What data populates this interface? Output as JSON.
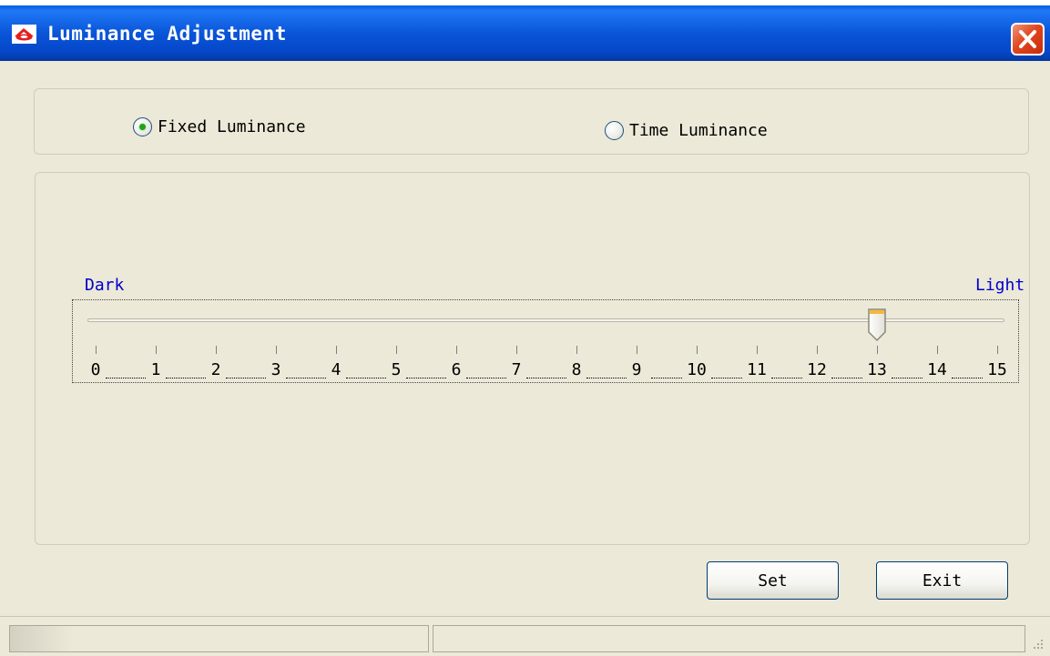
{
  "window": {
    "title": "Luminance Adjustment",
    "icon": "app-logo-icon",
    "close_icon": "close-icon"
  },
  "mode": {
    "options": [
      {
        "label": "Fixed Luminance",
        "selected": true
      },
      {
        "label": "Time Luminance",
        "selected": false
      }
    ],
    "selected": "Fixed Luminance"
  },
  "slider": {
    "min_label": "Dark",
    "max_label": "Light",
    "ticks": [
      "0",
      "1",
      "2",
      "3",
      "4",
      "5",
      "6",
      "7",
      "8",
      "9",
      "10",
      "11",
      "12",
      "13",
      "14",
      "15"
    ],
    "min": 0,
    "max": 15,
    "value": 13
  },
  "buttons": {
    "set_label": "Set",
    "exit_label": "Exit"
  },
  "colors": {
    "title_bar": "#0a55d8",
    "label_blue": "#0000cc",
    "radio_dot": "#21a121",
    "thumb_accent": "#f5b83a",
    "window_bg": "#ece9d8"
  }
}
